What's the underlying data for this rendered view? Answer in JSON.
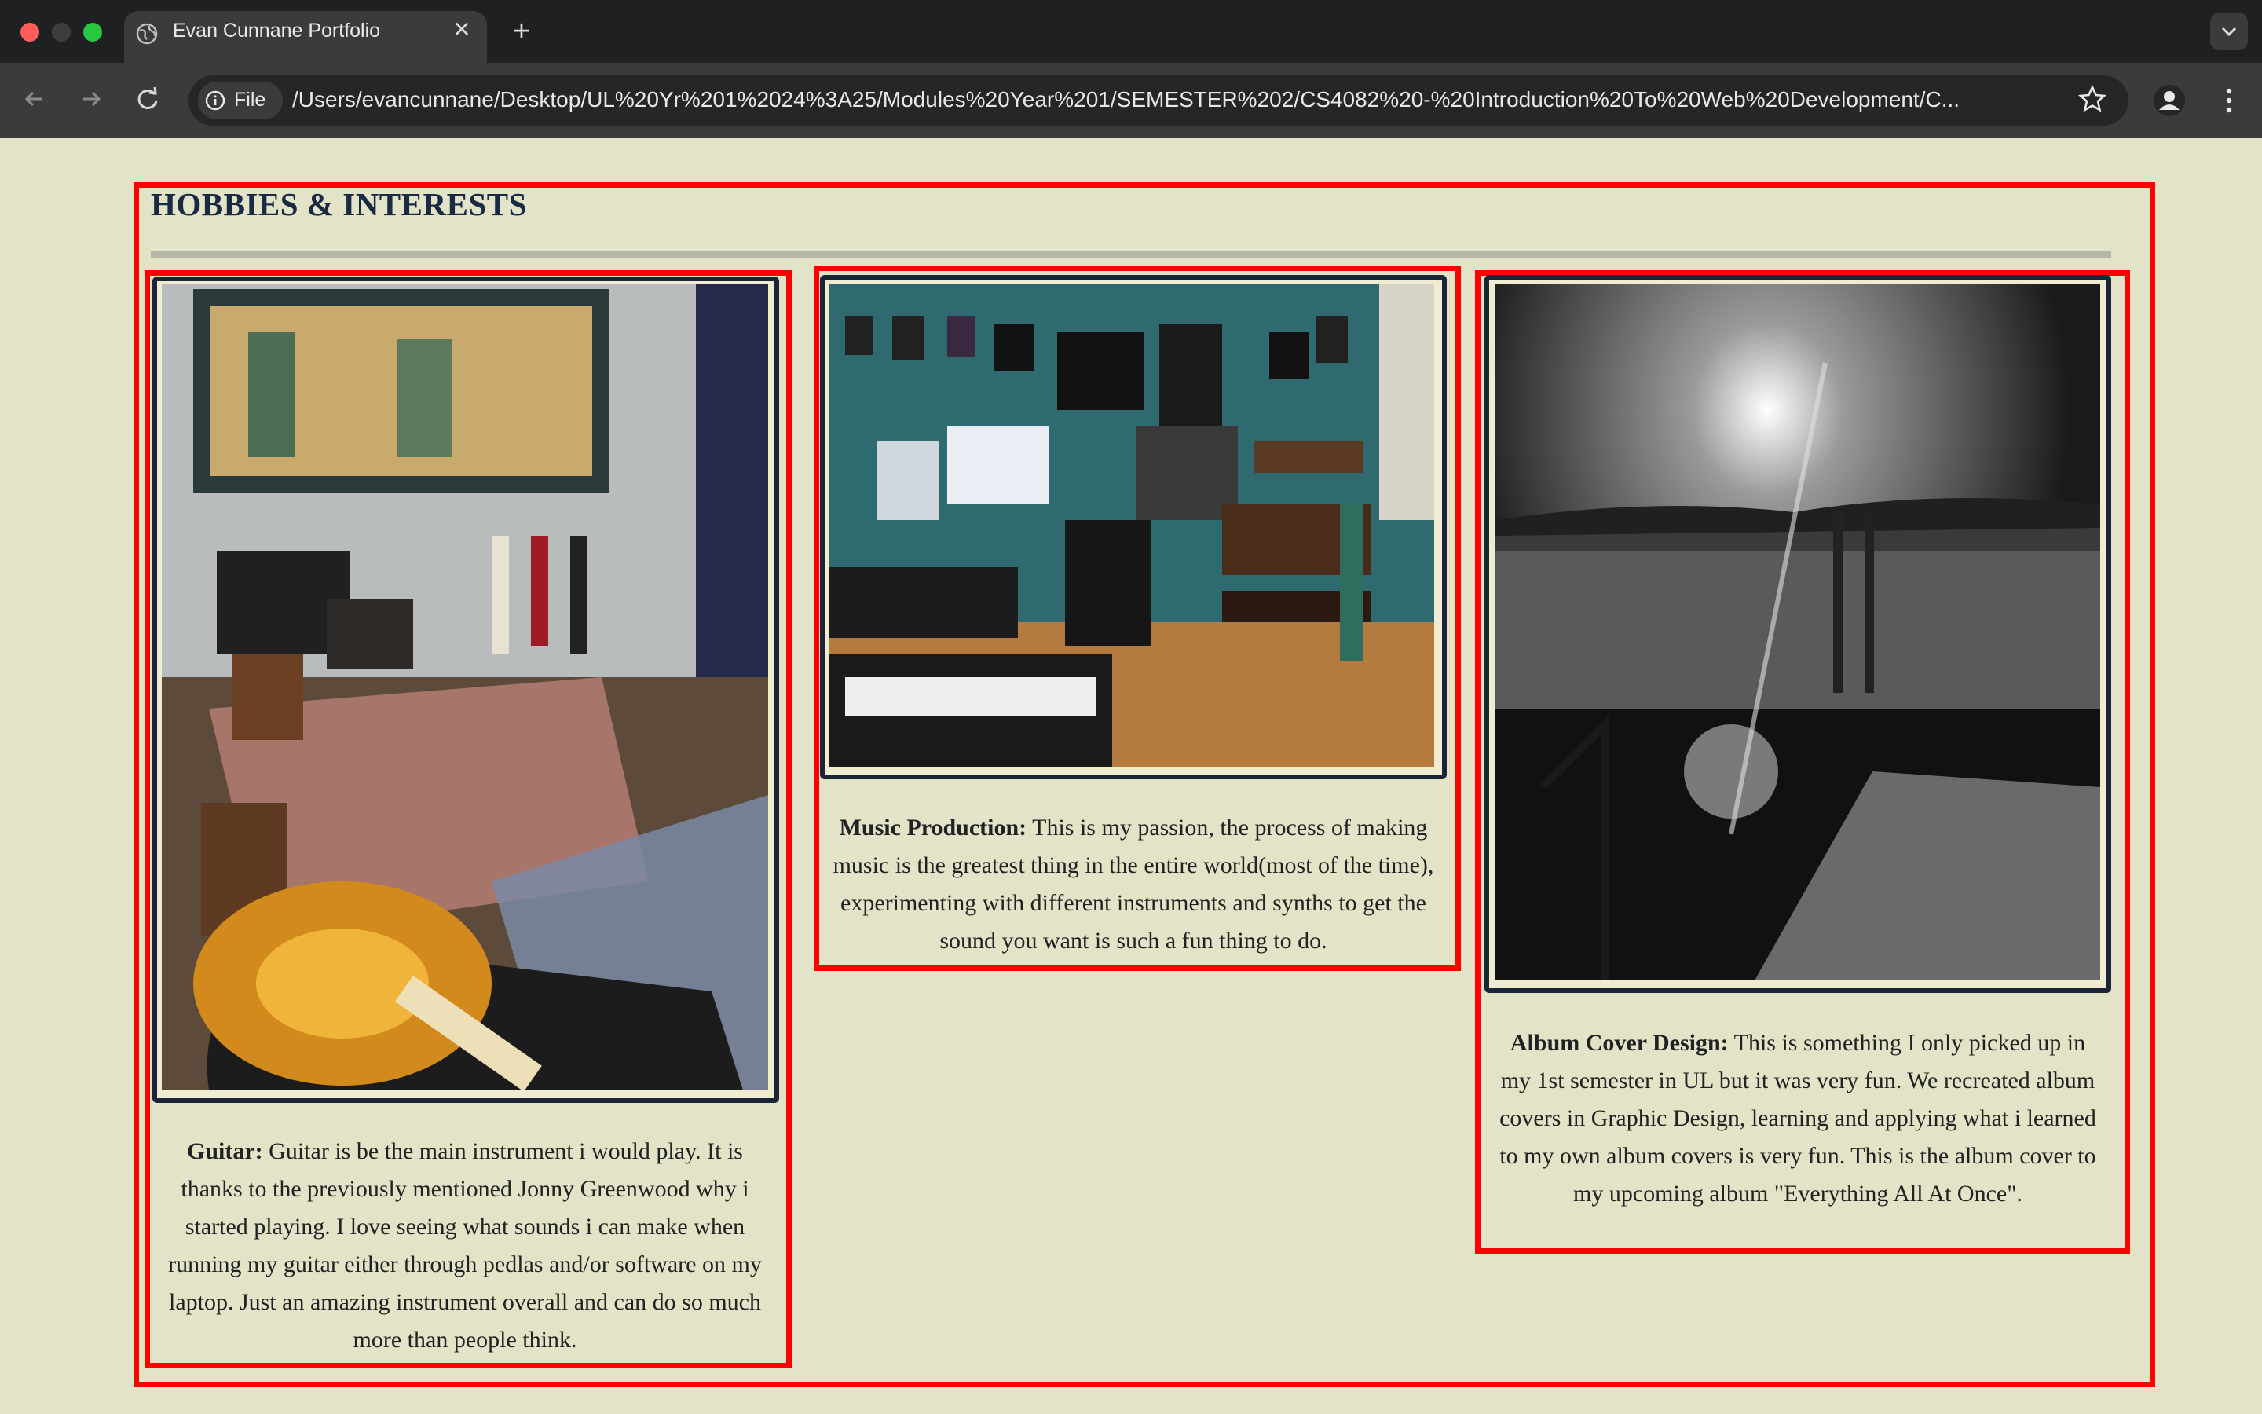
{
  "browser": {
    "tab_title": "Evan Cunnane Portfolio",
    "file_chip": "File",
    "url": "/Users/evancunnane/Desktop/UL%20Yr%201%2024%3A25/Modules%20Year%201/SEMESTER%202/CS4082%20-%20Introduction%20To%20Web%20Development/C..."
  },
  "section": {
    "heading": "HOBBIES & INTERESTS",
    "cards": [
      {
        "title": "Guitar:",
        "text": "Guitar is be the main instrument i would play. It is thanks to the previously mentioned Jonny Greenwood why i started playing. I love seeing what sounds i can make when running my guitar either through pedlas and/or software on my laptop. Just an amazing instrument overall and can do so much more than people think.",
        "image": "guitar-studio-photo"
      },
      {
        "title": "Music Production:",
        "text": "This is my passion, the process of making music is the greatest thing in the entire world(most of the time), experimenting with different instruments and synths to get the sound you want is such a fun thing to do.",
        "image": "music-studio-photo"
      },
      {
        "title": "Album Cover Design:",
        "text": "This is something I only picked up in my 1st semester in UL but it was very fun. We recreated album covers in Graphic Design, learning and applying what i learned to my own album covers is very fun. This is the album cover to my upcoming album \"Everything All At Once\".",
        "image": "album-cover-photo"
      }
    ]
  },
  "colors": {
    "page_bg": "#e3e3c8",
    "highlight_border": "#ff0000",
    "heading": "#1a2a44",
    "frame_border": "#1b2538"
  }
}
